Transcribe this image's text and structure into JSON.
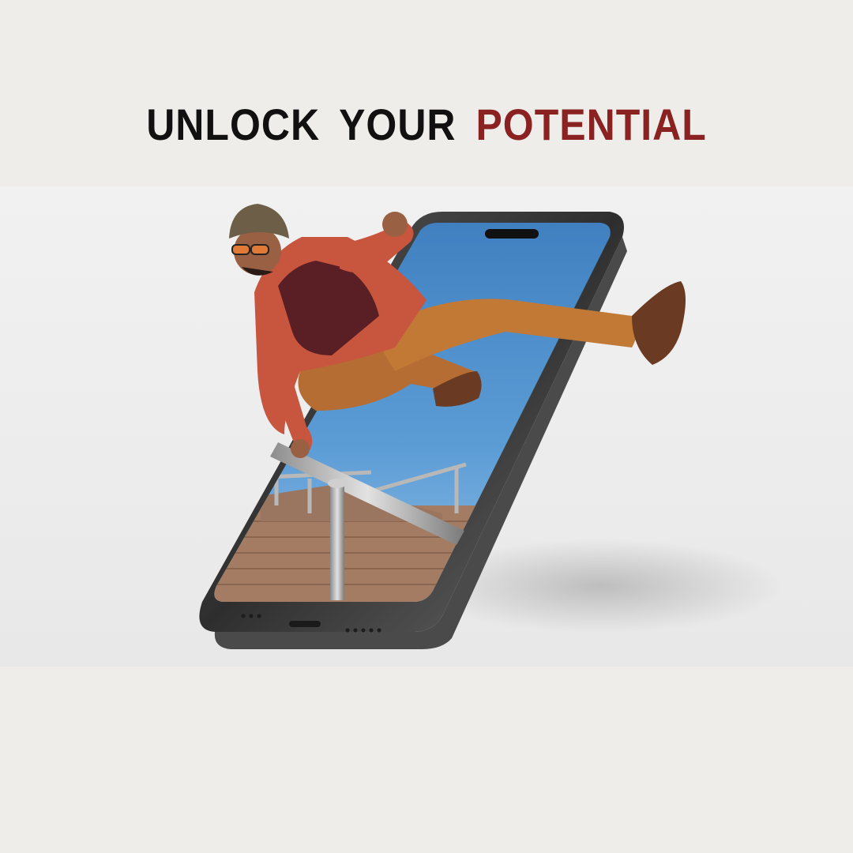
{
  "headline": {
    "part1": "UNLOCK",
    "part2": "YOUR",
    "part3": "POTENTIAL"
  },
  "colors": {
    "page_background": "#eeedea",
    "headline_text": "#111111",
    "headline_accent": "#8a2222",
    "phone_frame": "#3a3a3a",
    "screen_sky": "#4f8fc9",
    "jacket": "#c8553d",
    "trousers": "#b86f35"
  },
  "illustration": {
    "subject": "person-leaping-out-of-smartphone-screen"
  }
}
